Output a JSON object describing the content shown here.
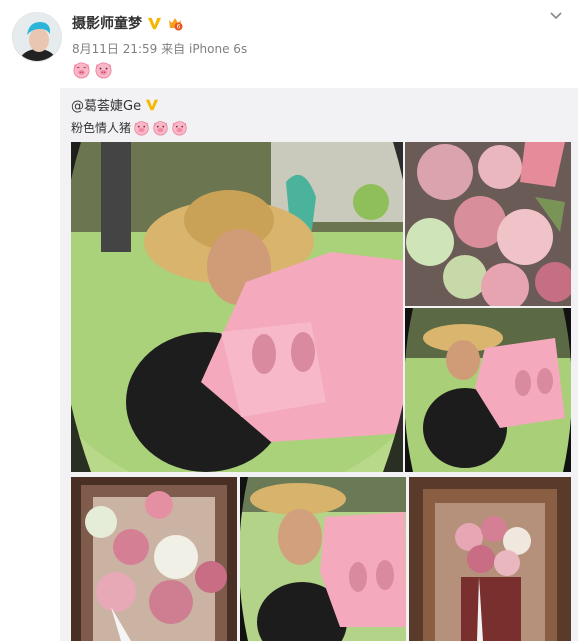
{
  "post": {
    "author": "摄影师童梦",
    "time": "8月11日 21:59",
    "source_prefix": "来自",
    "source": "iPhone 6s",
    "text_icons": [
      "pig-face-smile-emoji",
      "pig-face-emoji"
    ]
  },
  "repost": {
    "author": "@葛荟婕Ge",
    "text": "粉色情人猪",
    "text_icons": [
      "pig-face-emoji",
      "pig-face-emoji",
      "pig-face-emoji"
    ],
    "photos": [
      "girl-straw-hat-pink-pig-sculpture-photo",
      "pink-rose-bouquet-photo",
      "girl-kneeling-by-pink-pig-photo",
      "bouquet-in-wooden-frame-photo",
      "girl-pouting-pink-pig-photo",
      "framed-flower-display-photo"
    ]
  },
  "colors": {
    "verified": "#f5b800",
    "link_name": "#333333",
    "meta": "#808080",
    "repost_bg": "#f2f2f5",
    "pig_pink": "#f4a9bd"
  }
}
